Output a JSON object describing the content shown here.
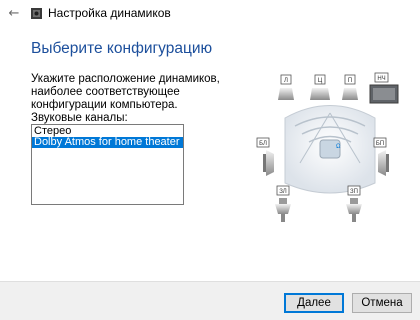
{
  "window": {
    "title": "Настройка динамиков",
    "back_icon": "back-arrow-icon",
    "app_icon": "speaker-setup-icon"
  },
  "main": {
    "heading": "Выберите конфигурацию",
    "instruction": "Укажите расположение динамиков, наиболее соответствующее конфигурации компьютера.",
    "channels_label": "Звуковые каналы:",
    "channels": [
      "Стерео",
      "Dolby Atmos for home theater"
    ],
    "selected_channel": "Dolby Atmos for home theater"
  },
  "diagram": {
    "speaker_labels": {
      "front_left": "Л",
      "center": "Ц",
      "front_right": "П",
      "subwoofer": "НЧ",
      "side_left": "БЛ",
      "side_right": "БП",
      "rear_left": "ЗЛ",
      "rear_right": "ЗП"
    }
  },
  "buttons": {
    "next": "Далее",
    "cancel": "Отмена"
  },
  "colors": {
    "accent": "#0078d7",
    "heading": "#1c4f9c",
    "bottom_bar": "#f0f0f0"
  }
}
